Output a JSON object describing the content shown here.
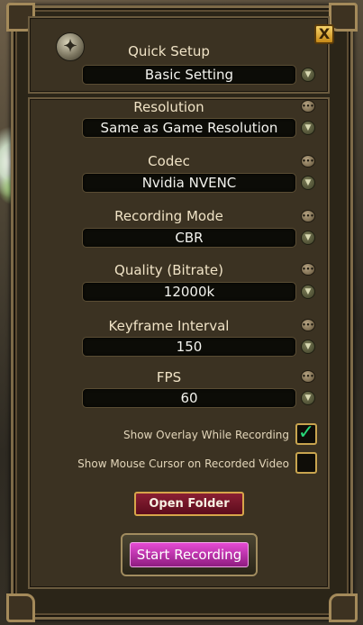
{
  "window": {
    "close_label": "X",
    "logo_glyph": "✦"
  },
  "quick_setup": {
    "label": "Quick Setup",
    "value": "Basic Setting"
  },
  "settings": [
    {
      "label": "Resolution",
      "value": "Same as Game Resolution"
    },
    {
      "label": "Codec",
      "value": "Nvidia NVENC"
    },
    {
      "label": "Recording Mode",
      "value": "CBR"
    },
    {
      "label": "Quality (Bitrate)",
      "value": "12000k"
    },
    {
      "label": "Keyframe Interval",
      "value": "150"
    },
    {
      "label": "FPS",
      "value": "60"
    }
  ],
  "options": {
    "show_overlay": {
      "label": "Show Overlay While Recording",
      "checked": true,
      "mark": "✓"
    },
    "show_cursor": {
      "label": "Show Mouse Cursor on Recorded Video",
      "checked": false
    }
  },
  "buttons": {
    "open_folder": "Open Folder",
    "start_recording": "Start Recording"
  },
  "icons": {
    "dropdown": "▼",
    "info": "•••"
  },
  "colors": {
    "accent_check": "#27d87a",
    "open_folder_bg": "#7a1429",
    "start_bg": "#d63bc4"
  }
}
